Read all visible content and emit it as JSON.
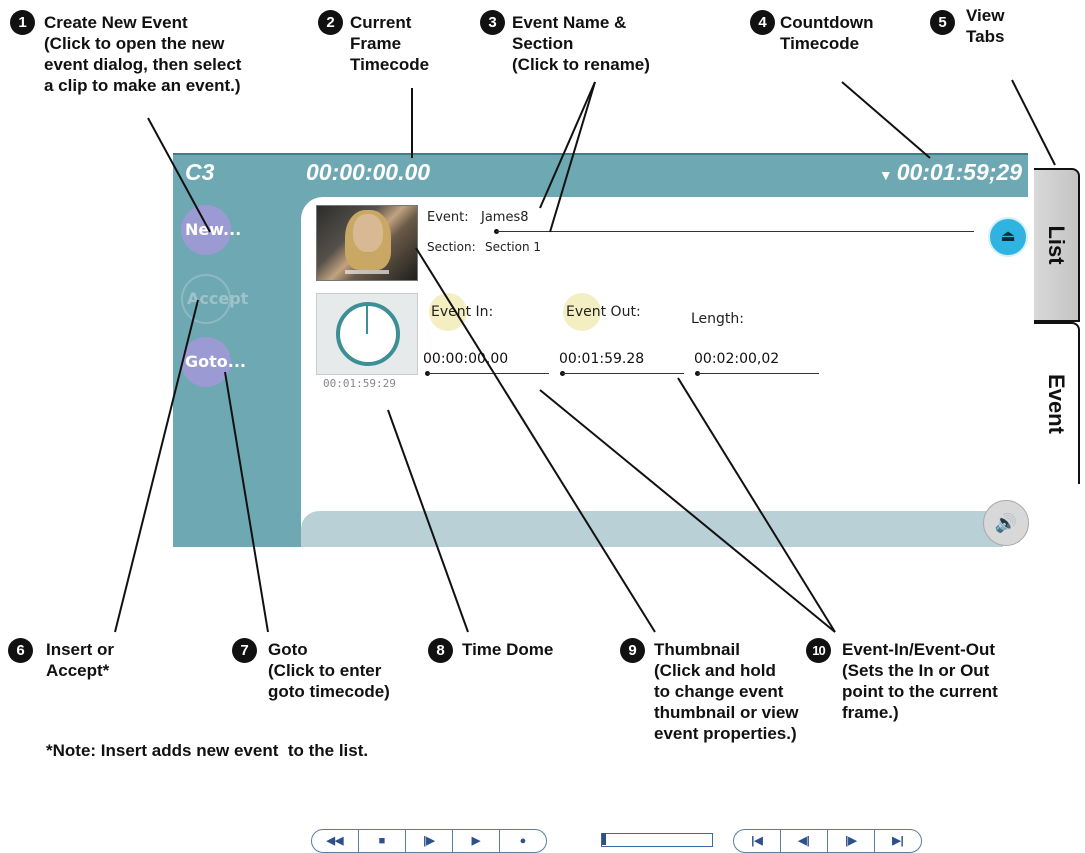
{
  "callouts": [
    {
      "num": "1",
      "text": "Create New Event\n(Click to open the new\nevent dialog, then select\na clip to make an event.)"
    },
    {
      "num": "2",
      "text": "Current\nFrame\nTimecode"
    },
    {
      "num": "3",
      "text": "Event Name &\nSection\n(Click to rename)"
    },
    {
      "num": "4",
      "text": "Countdown\nTimecode"
    },
    {
      "num": "5",
      "text": "View\nTabs"
    },
    {
      "num": "6",
      "text": "Insert or\nAccept*"
    },
    {
      "num": "7",
      "text": "Goto\n(Click to enter\ngoto timecode)"
    },
    {
      "num": "8",
      "text": "Time Dome"
    },
    {
      "num": "9",
      "text": "Thumbnail\n(Click and hold\nto change event\nthumbnail or view\nevent properties.)"
    },
    {
      "num": "10",
      "text": "Event-In/Event-Out\n(Sets the In or Out\npoint to the current\nframe.)"
    }
  ],
  "note": "*Note: Insert adds new event  to the list.",
  "panel": {
    "channel": "C3",
    "current_timecode": "00:00:00.00",
    "countdown_arrow": "▼",
    "countdown_timecode": "00:01:59;29",
    "buttons": {
      "new": "New...",
      "accept": "Accept",
      "goto": "Goto..."
    },
    "event_label": "Event:",
    "event_name": "James8",
    "section_label": "Section:",
    "section_name": "Section 1",
    "event_in_label": "Event In:",
    "event_out_label": "Event Out:",
    "length_label": "Length:",
    "event_in": "00:00:00.00",
    "event_out": "00:01:59.28",
    "length": "00:02:00,02",
    "dome_time": "00:01:59:29",
    "eject_icon": "⏏",
    "speaker_icon": "🔊"
  },
  "transport": {
    "left": [
      "◀◀",
      "■",
      "|▶",
      "▶",
      "●"
    ],
    "right": [
      "|◀",
      "◀|",
      "|▶",
      "▶|"
    ]
  },
  "tabs": {
    "list": "List",
    "event": "Event"
  }
}
